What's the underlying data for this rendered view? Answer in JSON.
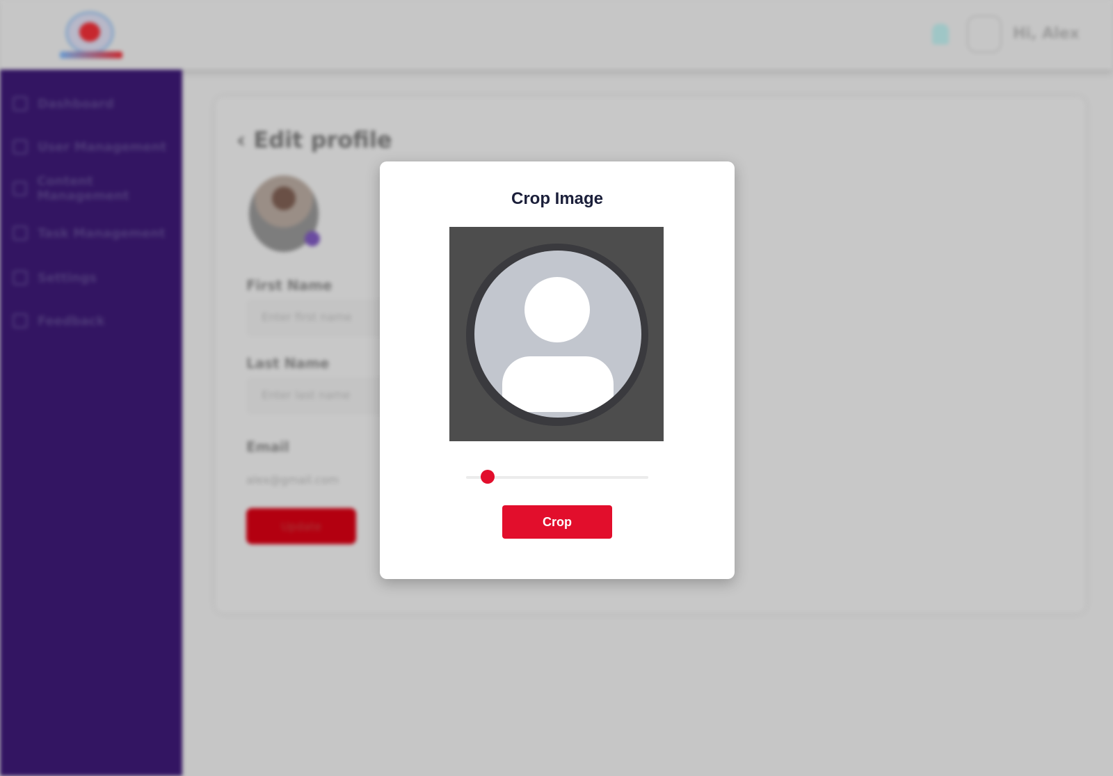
{
  "header": {
    "user_name": "Hi, Alex"
  },
  "sidebar": {
    "items": [
      {
        "label": "Dashboard",
        "icon": "grid-icon"
      },
      {
        "label": "User Management",
        "icon": "users-icon"
      },
      {
        "label": "Content Management",
        "icon": "document-icon"
      },
      {
        "label": "Task Management",
        "icon": "tasks-icon"
      },
      {
        "label": "Settings",
        "icon": "gear-icon"
      },
      {
        "label": "Feedback",
        "icon": "feedback-icon"
      }
    ]
  },
  "page": {
    "title": "Edit profile",
    "first_name_label": "First Name",
    "first_name_placeholder": "Enter first name",
    "last_name_label": "Last Name",
    "last_name_placeholder": "Enter last name",
    "email_label": "Email",
    "email_value": "alex@gmail.com",
    "submit_label": "Update"
  },
  "modal": {
    "title": "Crop Image",
    "crop_button_label": "Crop",
    "zoom_slider_value": 0.12
  },
  "colors": {
    "sidebar": "#331562",
    "accent": "#e20e2c",
    "modal_title": "#1b1f3a"
  }
}
